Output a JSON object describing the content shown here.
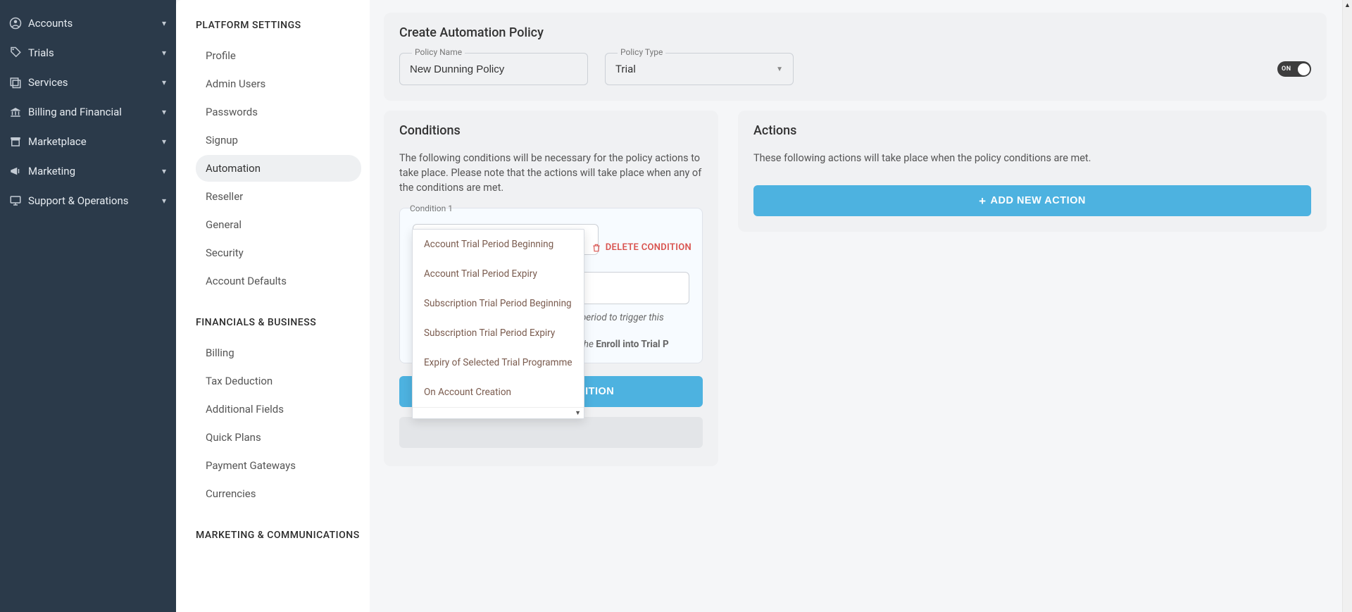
{
  "sidebar": {
    "items": [
      {
        "label": "Accounts",
        "icon": "person-circle-icon"
      },
      {
        "label": "Trials",
        "icon": "tag-icon"
      },
      {
        "label": "Services",
        "icon": "layers-icon"
      },
      {
        "label": "Billing and Financial",
        "icon": "bank-icon"
      },
      {
        "label": "Marketplace",
        "icon": "store-icon"
      },
      {
        "label": "Marketing",
        "icon": "megaphone-icon"
      },
      {
        "label": "Support & Operations",
        "icon": "monitor-icon"
      }
    ]
  },
  "settings": {
    "section1_title": "PLATFORM SETTINGS",
    "section1_items": [
      "Profile",
      "Admin Users",
      "Passwords",
      "Signup",
      "Automation",
      "Reseller",
      "General",
      "Security",
      "Account Defaults"
    ],
    "section1_active_index": 4,
    "section2_title": "FINANCIALS & BUSINESS",
    "section2_items": [
      "Billing",
      "Tax Deduction",
      "Additional Fields",
      "Quick Plans",
      "Payment Gateways",
      "Currencies"
    ],
    "section3_title": "MARKETING & COMMUNICATIONS"
  },
  "policy_card": {
    "title": "Create Automation Policy",
    "name_label": "Policy Name",
    "name_value": "New Dunning Policy",
    "type_label": "Policy Type",
    "type_value": "Trial",
    "toggle_on_text": "ON"
  },
  "conditions_card": {
    "title": "Conditions",
    "desc": "The following conditions will be necessary for the policy actions to take place. Please note that the actions will take place when any of the conditions are met.",
    "condition_label": "Condition 1",
    "delete_label": "DELETE CONDITION",
    "help_prefix": "Specify the amount of days before a trial period to trigger this condition",
    "help_note_prefix": "Note: Trial periods are only affected with the ",
    "help_note_bold": "Enroll into Trial P",
    "add_btn": "ADD NEW CONDITION",
    "dropdown_options": [
      "Account Trial Period Beginning",
      "Account Trial Period Expiry",
      "Subscription Trial Period Beginning",
      "Subscription Trial Period Expiry",
      "Expiry of Selected Trial Programme",
      "On Account Creation"
    ]
  },
  "actions_card": {
    "title": "Actions",
    "desc": "These following actions will take place when the policy conditions are met.",
    "add_btn": "ADD NEW ACTION"
  }
}
